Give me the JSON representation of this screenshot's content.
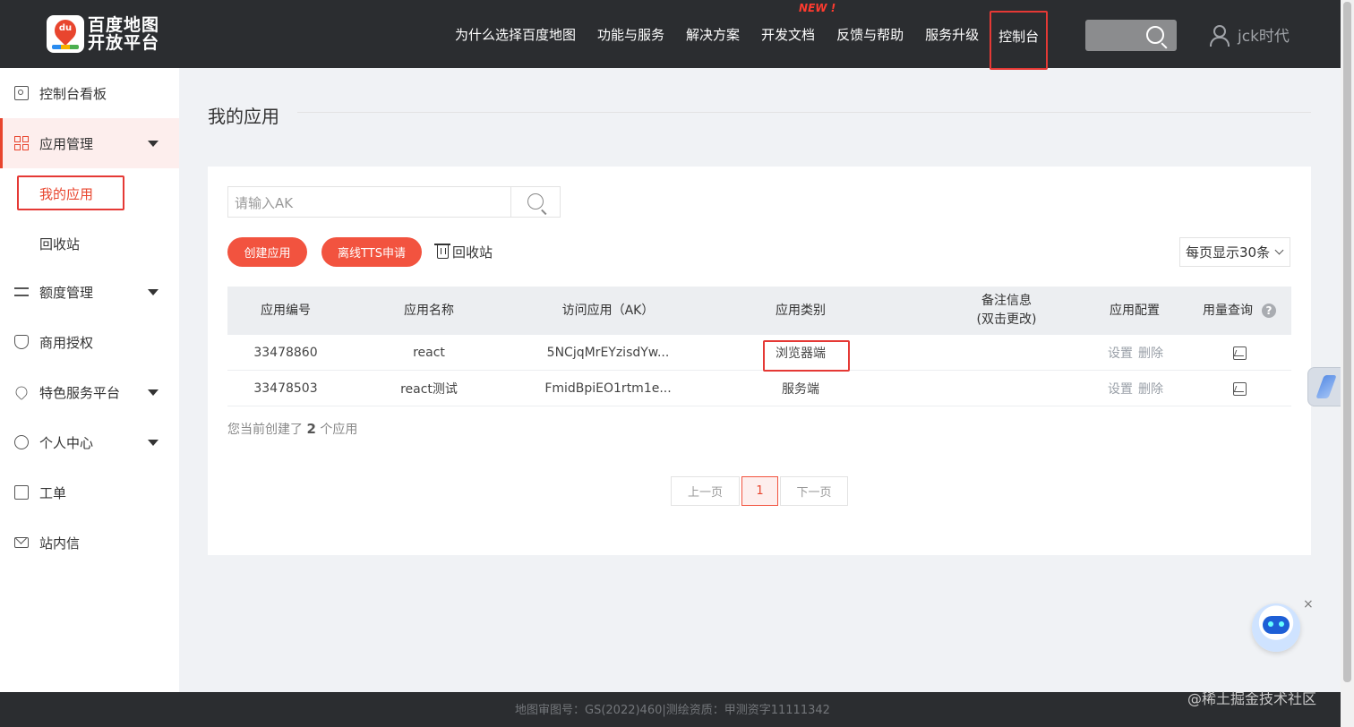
{
  "header": {
    "logo_line1": "百度地图",
    "logo_line2": "开放平台",
    "logo_badge": "du",
    "nav": [
      {
        "label": "为什么选择百度地图"
      },
      {
        "label": "功能与服务"
      },
      {
        "label": "解决方案"
      },
      {
        "label": "开发文档",
        "badge": "NEW !"
      },
      {
        "label": "反馈与帮助"
      },
      {
        "label": "服务升级"
      },
      {
        "label": "控制台",
        "active": true
      }
    ],
    "username": "jck时代"
  },
  "sidebar": {
    "items": [
      {
        "label": "控制台看板",
        "icon": "dashboard-icon"
      },
      {
        "label": "应用管理",
        "icon": "grid-icon",
        "expanded": true
      },
      {
        "label": "额度管理",
        "icon": "sliders-icon"
      },
      {
        "label": "商用授权",
        "icon": "shield-icon"
      },
      {
        "label": "特色服务平台",
        "icon": "heart-icon"
      },
      {
        "label": "个人中心",
        "icon": "person-icon"
      },
      {
        "label": "工单",
        "icon": "clipboard-icon"
      },
      {
        "label": "站内信",
        "icon": "mail-icon"
      }
    ],
    "subitems": [
      {
        "label": "我的应用",
        "current": true
      },
      {
        "label": "回收站"
      }
    ]
  },
  "main": {
    "title": "我的应用",
    "search_placeholder": "请输入AK",
    "create_button": "创建应用",
    "tts_button": "离线TTS申请",
    "recycle_label": "回收站",
    "per_page": "每页显示30条",
    "columns": [
      "应用编号",
      "应用名称",
      "访问应用（AK）",
      "应用类别",
      "备注信息",
      "(双击更改)",
      "应用配置",
      "用量查询"
    ],
    "rows": [
      {
        "id": "33478860",
        "name": "react",
        "ak": "5NCjqMrEYzisdYw...",
        "type": "浏览器端",
        "note": "",
        "settings": "设置",
        "delete": "删除"
      },
      {
        "id": "33478503",
        "name": "react测试",
        "ak": "FmidBpiEO1rtm1e...",
        "type": "服务端",
        "note": "",
        "settings": "设置",
        "delete": "删除"
      }
    ],
    "count_prefix": "您当前创建了",
    "count_value": "2",
    "count_suffix": "个应用",
    "pagination": {
      "prev": "上一页",
      "current": "1",
      "next": "下一页"
    }
  },
  "footer": {
    "text": "地图审图号：GS(2022)460|测绘资质：甲测资字11111342",
    "watermark": "@稀土掘金技术社区"
  },
  "widgets": {
    "close": "×"
  },
  "colors": {
    "accent": "#f2533f",
    "topbar": "#2b2d30",
    "highlight_box": "#e53935"
  }
}
